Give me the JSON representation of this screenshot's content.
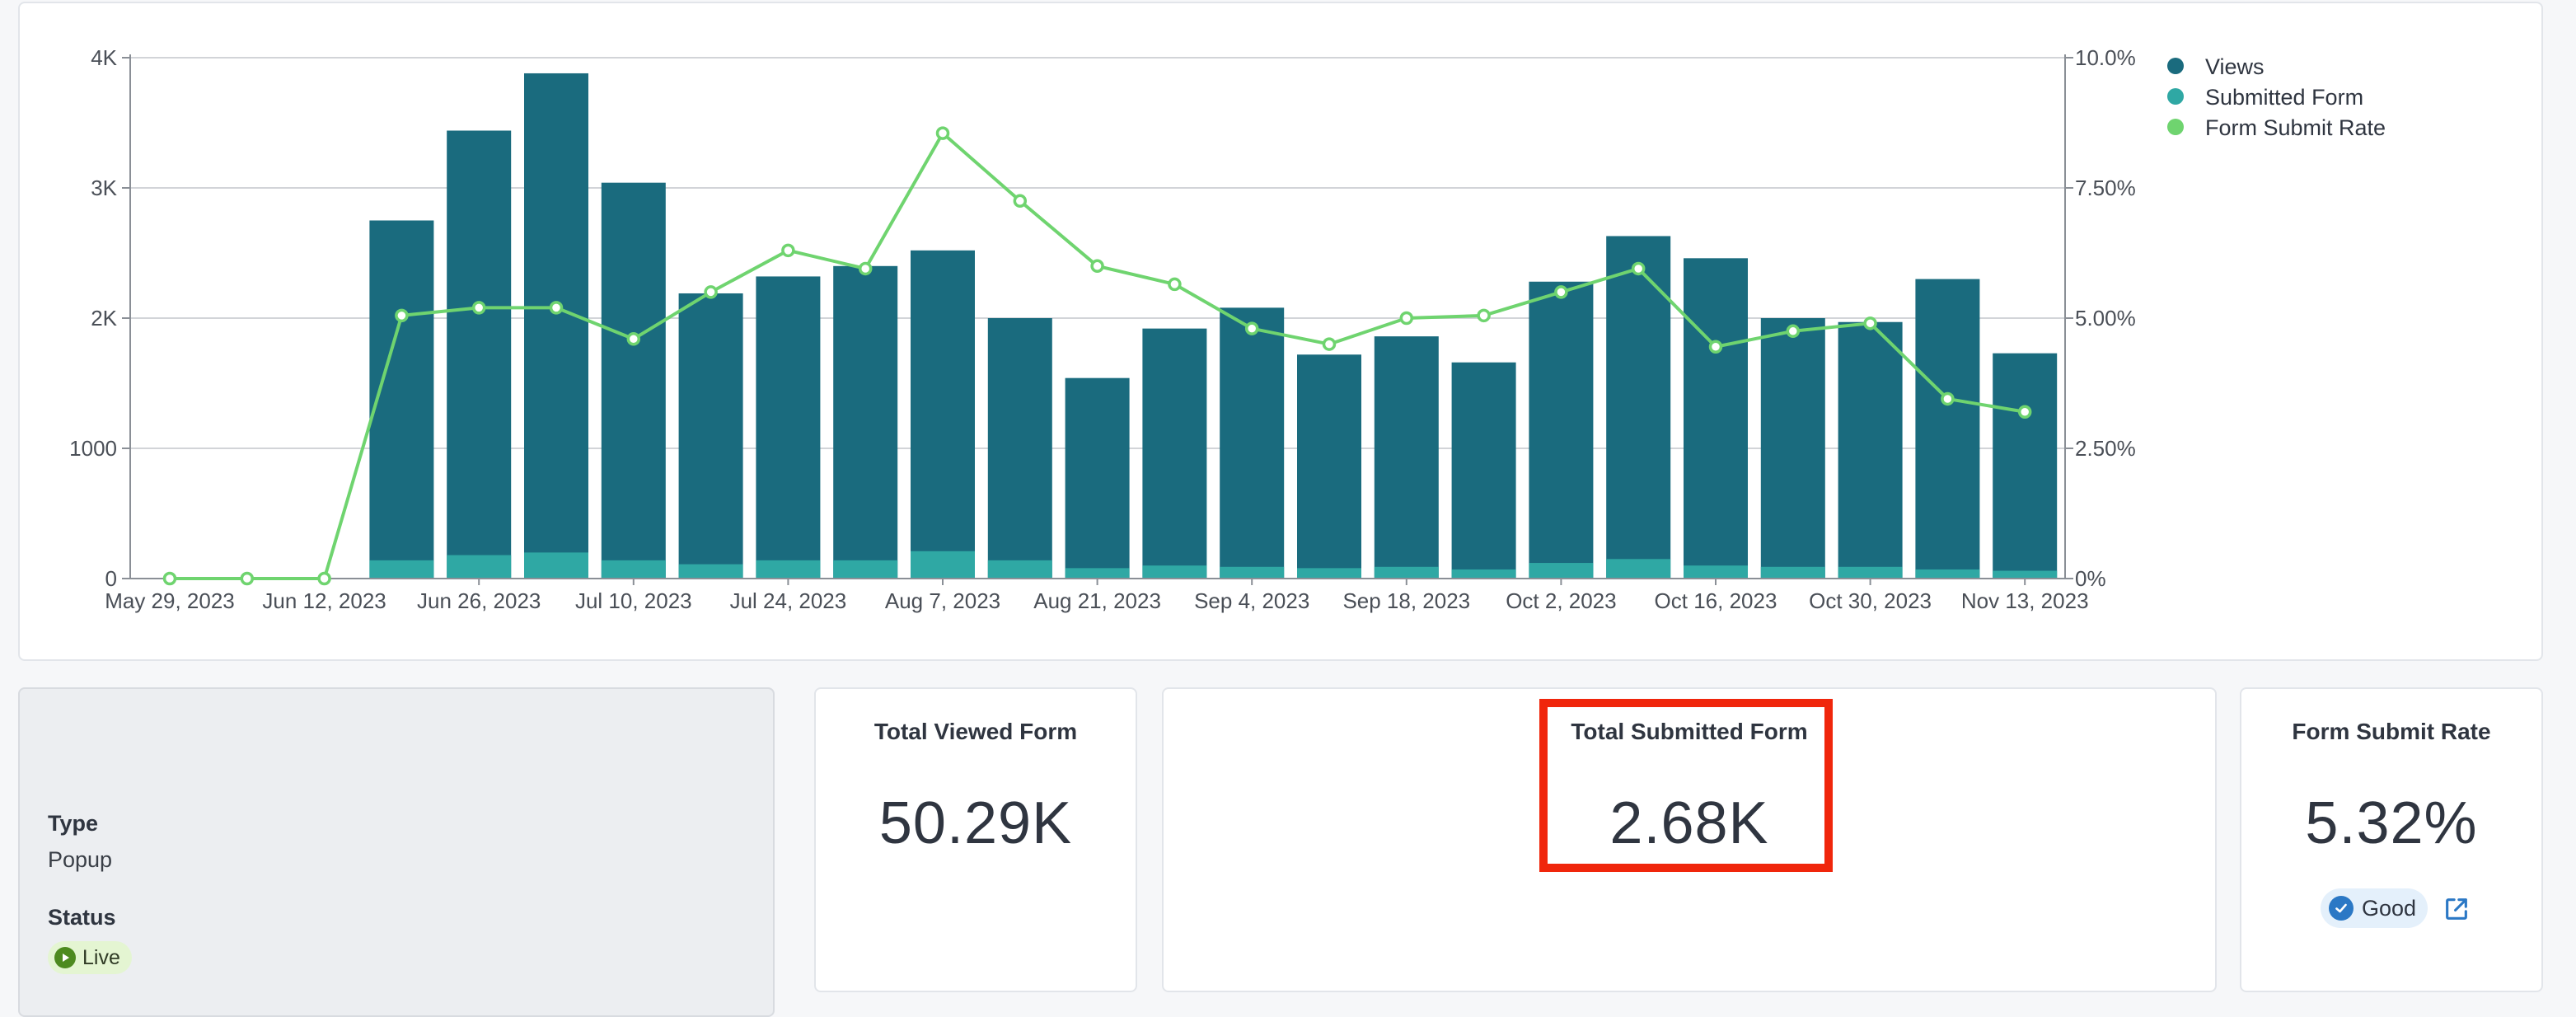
{
  "chart_data": {
    "type": "bar",
    "categories": [
      "May 29, 2023",
      "Jun 5, 2023",
      "Jun 12, 2023",
      "Jun 19, 2023",
      "Jun 26, 2023",
      "Jul 3, 2023",
      "Jul 10, 2023",
      "Jul 17, 2023",
      "Jul 24, 2023",
      "Jul 31, 2023",
      "Aug 7, 2023",
      "Aug 14, 2023",
      "Aug 21, 2023",
      "Aug 28, 2023",
      "Sep 4, 2023",
      "Sep 11, 2023",
      "Sep 18, 2023",
      "Sep 25, 2023",
      "Oct 2, 2023",
      "Oct 9, 2023",
      "Oct 16, 2023",
      "Oct 23, 2023",
      "Oct 30, 2023",
      "Nov 6, 2023",
      "Nov 13, 2023"
    ],
    "x_tick_labels": [
      "May 29, 2023",
      "Jun 12, 2023",
      "Jun 26, 2023",
      "Jul 10, 2023",
      "Jul 24, 2023",
      "Aug 7, 2023",
      "Aug 21, 2023",
      "Sep 4, 2023",
      "Sep 18, 2023",
      "Oct 2, 2023",
      "Oct 16, 2023",
      "Oct 30, 2023",
      "Nov 13, 2023"
    ],
    "series": [
      {
        "name": "Views",
        "color": "#1a6b7e",
        "values": [
          0,
          0,
          0,
          2750,
          3440,
          3880,
          3040,
          2190,
          2320,
          2400,
          2520,
          2000,
          1540,
          1920,
          2080,
          1720,
          1860,
          1660,
          2280,
          2630,
          2460,
          2000,
          1970,
          2300,
          1730
        ]
      },
      {
        "name": "Submitted Form",
        "color": "#2fa8a4",
        "values": [
          0,
          0,
          0,
          140,
          180,
          200,
          140,
          110,
          140,
          140,
          210,
          140,
          80,
          100,
          90,
          80,
          90,
          70,
          120,
          150,
          100,
          90,
          90,
          70,
          60
        ]
      },
      {
        "name": "Form Submit Rate",
        "color": "#6fd46f",
        "type": "line",
        "axis": "right",
        "values": [
          0,
          0,
          0,
          5.05,
          5.2,
          5.2,
          4.6,
          5.5,
          6.3,
          5.95,
          8.55,
          7.25,
          6.0,
          5.65,
          4.8,
          4.5,
          5.0,
          5.05,
          5.5,
          5.95,
          4.45,
          4.75,
          4.9,
          3.45,
          3.2
        ]
      }
    ],
    "y_left": {
      "ticks": [
        "0",
        "1000",
        "2K",
        "3K",
        "4K"
      ],
      "ylim": [
        0,
        4000
      ]
    },
    "y_right": {
      "ticks": [
        "0%",
        "2.50%",
        "5.00%",
        "7.50%",
        "10.0%"
      ],
      "ylim": [
        0,
        10
      ]
    },
    "legend_position": "top-right",
    "grid": true
  },
  "info": {
    "type_label": "Type",
    "type_value": "Popup",
    "status_label": "Status",
    "status_value": "Live"
  },
  "stats": {
    "viewed_title": "Total Viewed Form",
    "viewed_value": "50.29K",
    "submitted_title": "Total Submitted Form",
    "submitted_value": "2.68K",
    "rate_title": "Form Submit Rate",
    "rate_value": "5.32%",
    "rate_badge": "Good"
  },
  "colors": {
    "highlight": "#f0260c",
    "good_badge_icon": "#2b78c5",
    "live_badge_icon": "#4d8a1f"
  }
}
